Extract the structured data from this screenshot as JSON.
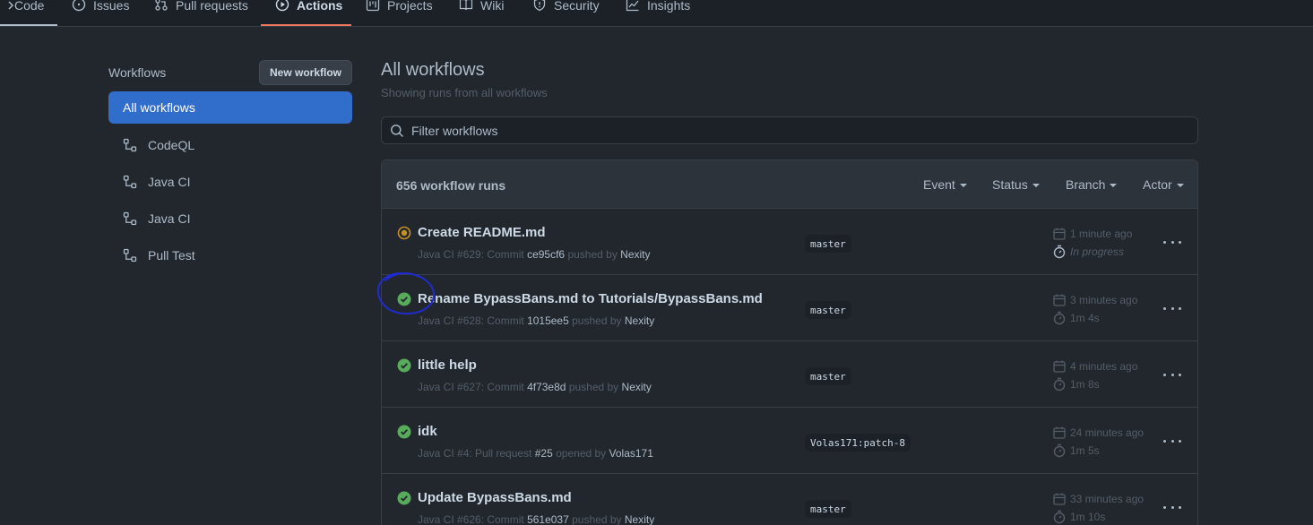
{
  "nav": {
    "code": "Code",
    "issues": "Issues",
    "pull_requests": "Pull requests",
    "actions": "Actions",
    "projects": "Projects",
    "wiki": "Wiki",
    "security": "Security",
    "insights": "Insights"
  },
  "sidebar": {
    "title": "Workflows",
    "new_workflow": "New workflow",
    "items": [
      {
        "label": "All workflows"
      },
      {
        "label": "CodeQL"
      },
      {
        "label": "Java CI"
      },
      {
        "label": "Java CI"
      },
      {
        "label": "Pull Test"
      }
    ]
  },
  "main": {
    "title": "All workflows",
    "subtitle": "Showing runs from all workflows",
    "filter_placeholder": "Filter workflows",
    "run_count": "656 workflow runs",
    "filters": {
      "event": "Event",
      "status": "Status",
      "branch": "Branch",
      "actor": "Actor"
    }
  },
  "runs": [
    {
      "status": "in-progress",
      "title": "Create README.md",
      "meta_prefix": "Java CI #629: Commit",
      "ref": "ce95cf6",
      "meta_mid": "pushed by",
      "actor": "Nexity",
      "branch": "master",
      "time": "1 minute ago",
      "duration": "In progress"
    },
    {
      "status": "success",
      "title": "Rename BypassBans.md to Tutorials/BypassBans.md",
      "meta_prefix": "Java CI #628: Commit",
      "ref": "1015ee5",
      "meta_mid": "pushed by",
      "actor": "Nexity",
      "branch": "master",
      "time": "3 minutes ago",
      "duration": "1m 4s"
    },
    {
      "status": "success",
      "title": "little help",
      "meta_prefix": "Java CI #627: Commit",
      "ref": "4f73e8d",
      "meta_mid": "pushed by",
      "actor": "Nexity",
      "branch": "master",
      "time": "4 minutes ago",
      "duration": "1m 8s"
    },
    {
      "status": "success",
      "title": "idk",
      "meta_prefix": "Java CI #4: Pull request",
      "ref": "#25",
      "meta_mid": "opened by",
      "actor": "Volas171",
      "branch": "Volas171:patch-8",
      "time": "24 minutes ago",
      "duration": "1m 5s"
    },
    {
      "status": "success",
      "title": "Update BypassBans.md",
      "meta_prefix": "Java CI #626: Commit",
      "ref": "561e037",
      "meta_mid": "pushed by",
      "actor": "Nexity",
      "branch": "master",
      "time": "33 minutes ago",
      "duration": "1m 10s"
    }
  ],
  "colors": {
    "success": "#57ab5a",
    "in_progress": "#c69026",
    "accent": "#316dca",
    "active_tab": "#ec775c",
    "annotation": "#1f2bd1"
  }
}
